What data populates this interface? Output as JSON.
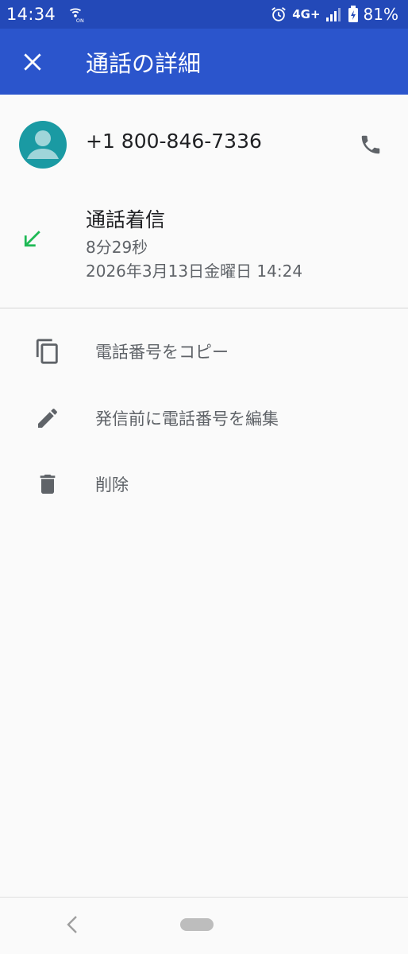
{
  "status_bar": {
    "time": "14:34",
    "network": "4G+",
    "battery": "81%"
  },
  "app_bar": {
    "title": "通話の詳細"
  },
  "contact": {
    "phone_number": "+1 800-846-7336"
  },
  "call": {
    "type": "通話着信",
    "duration": "8分29秒",
    "datetime": "2026年3月13日金曜日 14:24"
  },
  "actions": [
    {
      "label": "電話番号をコピー",
      "icon": "copy-icon"
    },
    {
      "label": "発信前に電話番号を編集",
      "icon": "pencil-icon"
    },
    {
      "label": "削除",
      "icon": "trash-icon"
    }
  ],
  "colors": {
    "status_bar": "#2349b8",
    "app_bar": "#2b55cc",
    "avatar": "#1a9aa3",
    "incoming_arrow": "#1db954",
    "icon_gray": "#5f6368"
  }
}
